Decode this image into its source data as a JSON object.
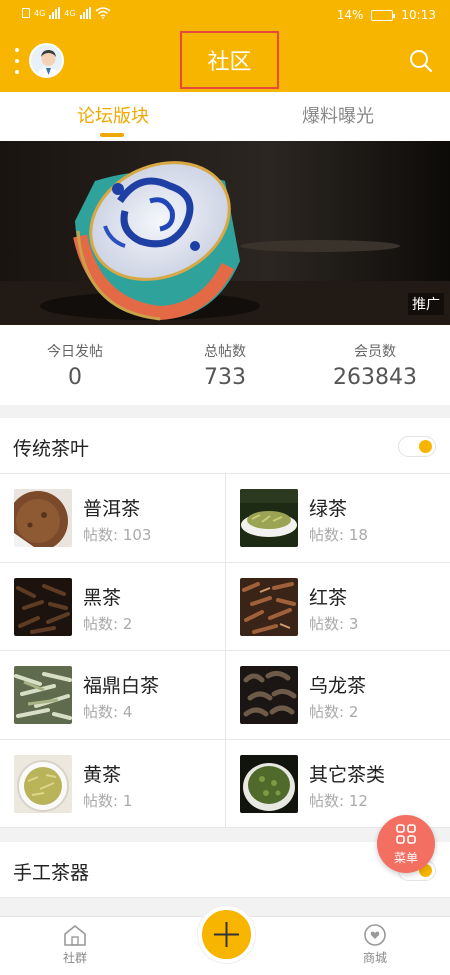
{
  "status_bar": {
    "battery": "14%",
    "time": "10:13",
    "network_a": "4G",
    "network_b": "4G"
  },
  "header": {
    "title": "社区"
  },
  "tabs": [
    {
      "label": "论坛版块",
      "active": true
    },
    {
      "label": "爆料曝光",
      "active": false
    }
  ],
  "banner": {
    "tag": "推广"
  },
  "stats": [
    {
      "label": "今日发帖",
      "value": "0"
    },
    {
      "label": "总帖数",
      "value": "733"
    },
    {
      "label": "会员数",
      "value": "263843"
    }
  ],
  "sections": [
    {
      "title": "传统茶叶",
      "toggle_on": true
    },
    {
      "title": "手工茶器",
      "toggle_on": true
    }
  ],
  "categories": [
    {
      "name": "普洱茶",
      "count": "帖数: 103"
    },
    {
      "name": "绿茶",
      "count": "帖数: 18"
    },
    {
      "name": "黑茶",
      "count": "帖数: 2"
    },
    {
      "name": "红茶",
      "count": "帖数: 3"
    },
    {
      "name": "福鼎白茶",
      "count": "帖数: 4"
    },
    {
      "name": "乌龙茶",
      "count": "帖数: 2"
    },
    {
      "name": "黄茶",
      "count": "帖数: 1"
    },
    {
      "name": "其它茶类",
      "count": "帖数: 12"
    }
  ],
  "menu_fab": {
    "label": "菜单"
  },
  "bottom_nav": {
    "left": "社群",
    "right": "商城"
  },
  "colors": {
    "accent": "#f7b500",
    "fab": "#f26f62",
    "highlight_box": "#e64a3c"
  }
}
